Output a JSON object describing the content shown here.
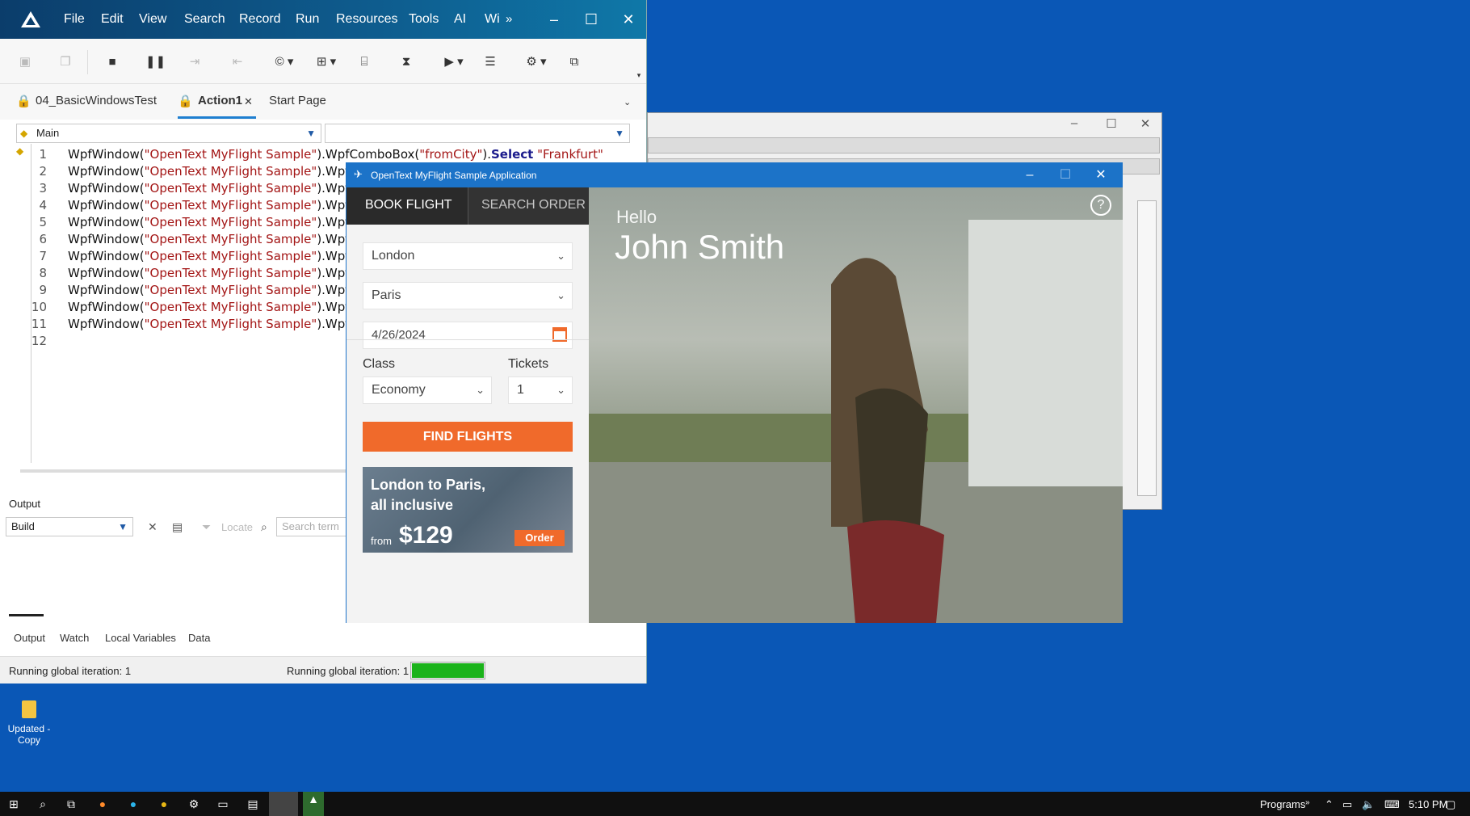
{
  "ide": {
    "menu": [
      "File",
      "Edit",
      "View",
      "Search",
      "Record",
      "Run",
      "Resources",
      "Tools",
      "AI",
      "Wi"
    ],
    "tabs": [
      {
        "label": "04_BasicWindowsTest"
      },
      {
        "label": "Action1"
      },
      {
        "label": "Start Page"
      }
    ],
    "combo_left": "Main",
    "combo_right": "",
    "code_lines": [
      {
        "n": "1",
        "pre": "WpfWindow(",
        "s1": "\"OpenText MyFlight Sample\"",
        "mid": ").WpfComboBox(",
        "s2": "\"fromCity\"",
        "post": ").",
        "kw": "Select",
        "sp": " ",
        "s3": "\"Frankfurt\""
      },
      {
        "n": "2",
        "pre": "WpfWindow(",
        "s1": "\"OpenText MyFlight Sample\"",
        "mid": ").WpfCo"
      },
      {
        "n": "3",
        "pre": "WpfWindow(",
        "s1": "\"OpenText MyFlight Sample\"",
        "mid": ").WpfCa"
      },
      {
        "n": "4",
        "pre": "WpfWindow(",
        "s1": "\"OpenText MyFlight Sample\"",
        "mid": ").WpfCo"
      },
      {
        "n": "5",
        "pre": "WpfWindow(",
        "s1": "\"OpenText MyFlight Sample\"",
        "mid": ").WpfCo"
      },
      {
        "n": "6",
        "pre": "WpfWindow(",
        "s1": "\"OpenText MyFlight Sample\"",
        "mid": ").WpfBu"
      },
      {
        "n": "7",
        "pre": "WpfWindow(",
        "s1": "\"OpenText MyFlight Sample\"",
        "mid": ").WpfTa"
      },
      {
        "n": "8",
        "pre": "WpfWindow(",
        "s1": "\"OpenText MyFlight Sample\"",
        "mid": ").WpfBu"
      },
      {
        "n": "9",
        "pre": "WpfWindow(",
        "s1": "\"OpenText MyFlight Sample\"",
        "mid": ").WpfEd"
      },
      {
        "n": "10",
        "pre": "WpfWindow(",
        "s1": "\"OpenText MyFlight Sample\"",
        "mid": ").WpfBu"
      },
      {
        "n": "11",
        "pre": "WpfWindow(",
        "s1": "\"OpenText MyFlight Sample\"",
        "mid": ").WpfBu"
      },
      {
        "n": "12"
      }
    ],
    "output": {
      "title": "Output",
      "combo": "Build",
      "locate": "Locate",
      "search_placeholder": "Search term"
    },
    "bottom_tabs": [
      "Output",
      "Watch",
      "Local Variables",
      "Data"
    ],
    "status_left": "Running global iteration: 1",
    "status_right": "Running global iteration: 1",
    "progress": 1.0,
    "progress_color": "#1bb31b"
  },
  "myflight": {
    "title": "OpenText MyFlight Sample Application",
    "tabs": [
      "BOOK FLIGHT",
      "SEARCH ORDER"
    ],
    "from": "London",
    "to": "Paris",
    "date": "4/26/2024",
    "class_label": "Class",
    "class_value": "Economy",
    "tickets_label": "Tickets",
    "tickets_value": "1",
    "find_button": "FIND FLIGHTS",
    "promo": {
      "headline": "London to Paris, all inclusive",
      "from": "from",
      "price": "$129",
      "order": "Order"
    },
    "hello": "Hello",
    "user": "John Smith",
    "help": "?",
    "accent": "#f06a2b",
    "title_bar_color": "#1c73c8"
  },
  "desktop": {
    "icon_label": "Updated - Copy"
  },
  "taskbar": {
    "programs": "Programs",
    "time": "5:10 PM"
  }
}
